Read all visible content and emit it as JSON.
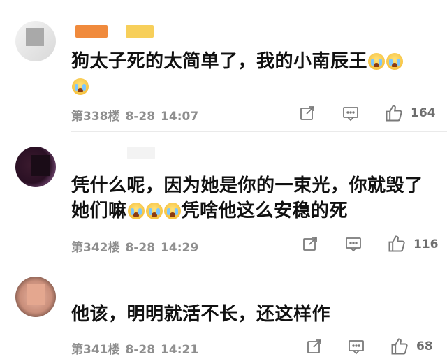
{
  "comments": [
    {
      "text_lines": [
        "狗太子死的太简单了，我的小南辰王",
        ""
      ],
      "floor": "第338楼",
      "date": "8-28",
      "time": "14:07",
      "likes": "164",
      "emoji_name": "crying-emoji"
    },
    {
      "text_lines": [
        "凭什么呢，因为她是你的一束光，你就毁了",
        "她们嘛",
        "凭啥他这么安稳的死"
      ],
      "floor": "第342楼",
      "date": "8-28",
      "time": "14:29",
      "likes": "116",
      "emoji_name": "crying-emoji"
    },
    {
      "text_lines": [
        "他该，明明就活不长，还这样作"
      ],
      "floor": "第341楼",
      "date": "8-28",
      "time": "14:21",
      "likes": "68"
    }
  ],
  "icons": {
    "forward": "share-edit-icon",
    "comment": "comment-icon",
    "like": "thumbs-up-icon"
  },
  "colors": {
    "text": "#111111",
    "meta": "#8e8e8e",
    "divider": "#eaeaea",
    "emoji": "#f6c343"
  }
}
